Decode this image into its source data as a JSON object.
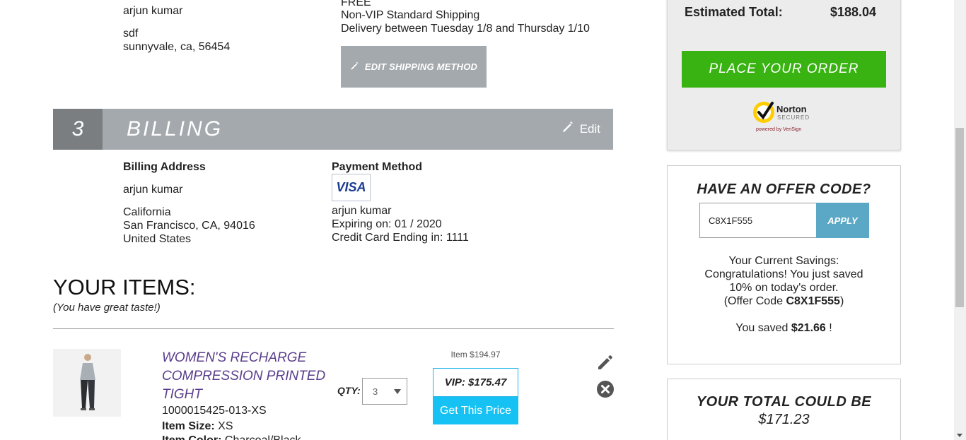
{
  "shipping": {
    "name": "arjun kumar",
    "address_line1": "sdf",
    "address_line2": "sunnyvale, ca, 56454",
    "price": "FREE",
    "method": "Non-VIP Standard Shipping",
    "delivery": "Delivery between Tuesday 1/8 and Thursday 1/10",
    "edit_label": "EDIT SHIPPING METHOD"
  },
  "billing": {
    "step": "3",
    "title": "BILLING",
    "edit_label": "Edit",
    "address_label": "Billing Address",
    "name": "arjun kumar",
    "address_line1": "California",
    "address_line2": "San Francisco, CA, 94016",
    "address_line3": "United States",
    "payment_label": "Payment Method",
    "card_brand": "VISA",
    "card_name": "arjun kumar",
    "expiring": "Expiring on: 01 / 2020",
    "card_ending": "Credit Card Ending in: 1111"
  },
  "items": {
    "title": "YOUR ITEMS:",
    "subtitle": "(You have great taste!)",
    "product": {
      "name": "WOMEN'S RECHARGE COMPRESSION PRINTED TIGHT",
      "sku": "1000015425-013-XS",
      "size_label": "Item Size:",
      "size_value": "XS",
      "color_label": "Item Color:",
      "color_value": "Charcoal/Black",
      "qty_label": "QTY:",
      "qty_value": "3",
      "item_price": "Item $194.97",
      "vip_price": "VIP: $175.47",
      "get_price_label": "Get This Price"
    }
  },
  "summary": {
    "estimated_label": "Estimated Total:",
    "estimated_value": "$188.04",
    "place_order_label": "PLACE YOUR ORDER",
    "norton_label": "Norton",
    "norton_secured": "SECURED",
    "norton_powered": "powered by VeriSign"
  },
  "offer": {
    "title": "HAVE AN OFFER CODE?",
    "code_value": "C8X1F555",
    "apply_label": "APPLY",
    "savings_line1": "Your Current Savings:",
    "savings_line2": "Congratulations! You just saved",
    "savings_line3": "10% on today's order.",
    "offer_code_prefix": "(Offer Code ",
    "offer_code": "C8X1F555",
    "offer_code_suffix": ")",
    "saved_prefix": "You saved ",
    "saved_amount": "$21.66",
    "saved_suffix": " !"
  },
  "total": {
    "title": "YOUR TOTAL COULD BE",
    "value": "$171.23"
  },
  "colors": {
    "place_order": "#38b311",
    "billing_bar": "#a4a9ad",
    "get_price": "#16c2f3",
    "apply": "#5aa8c6",
    "product_name": "#5a3e8c"
  }
}
